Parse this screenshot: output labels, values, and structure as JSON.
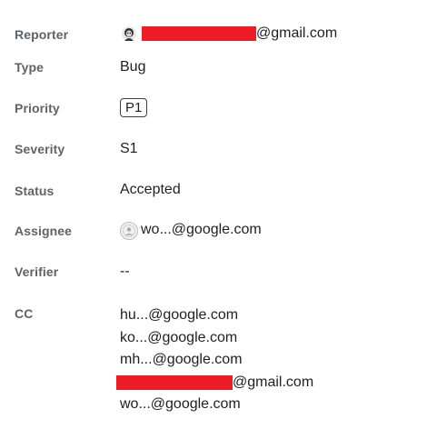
{
  "fields": {
    "reporter": {
      "label": "Reporter",
      "email_suffix": "@gmail.com"
    },
    "type": {
      "label": "Type",
      "value": "Bug"
    },
    "priority": {
      "label": "Priority",
      "value": "P1"
    },
    "severity": {
      "label": "Severity",
      "value": "S1"
    },
    "status": {
      "label": "Status",
      "value": "Accepted"
    },
    "assignee": {
      "label": "Assignee",
      "value": "wo...@google.com"
    },
    "verifier": {
      "label": "Verifier",
      "value": "--"
    },
    "cc": {
      "label": "CC",
      "items": [
        "hu...@google.com",
        "ko...@google.com",
        "mh...@google.com",
        "@gmail.com",
        "wo...@google.com"
      ]
    }
  },
  "icons": {
    "reporter_avatar": "user-avatar-icon",
    "assignee_avatar": "user-avatar-icon"
  },
  "colors": {
    "redaction": "#ee1c25",
    "label": "#5f6368",
    "value": "#202124"
  }
}
